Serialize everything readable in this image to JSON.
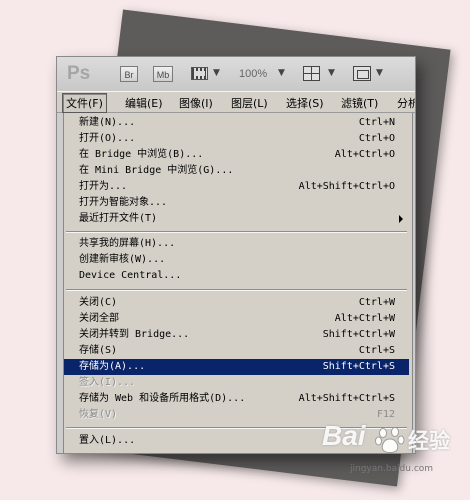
{
  "app": {
    "logo": "Ps",
    "bridge_button": "Br",
    "mini_bridge_button": "Mb",
    "zoom": "100%"
  },
  "menubar": [
    {
      "label": "文件(F)",
      "active": true
    },
    {
      "label": "编辑(E)"
    },
    {
      "label": "图像(I)"
    },
    {
      "label": "图层(L)"
    },
    {
      "label": "选择(S)"
    },
    {
      "label": "滤镜(T)"
    },
    {
      "label": "分析"
    }
  ],
  "file_menu": [
    {
      "label": "新建(N)...",
      "shortcut": "Ctrl+N"
    },
    {
      "label": "打开(O)...",
      "shortcut": "Ctrl+O"
    },
    {
      "label": "在 Bridge 中浏览(B)...",
      "shortcut": "Alt+Ctrl+O"
    },
    {
      "label": "在 Mini Bridge 中浏览(G)...",
      "shortcut": ""
    },
    {
      "label": "打开为...",
      "shortcut": "Alt+Shift+Ctrl+O"
    },
    {
      "label": "打开为智能对象...",
      "shortcut": ""
    },
    {
      "label": "最近打开文件(T)",
      "shortcut": "",
      "submenu": true
    },
    {
      "separator": true
    },
    {
      "label": "共享我的屏幕(H)...",
      "shortcut": ""
    },
    {
      "label": "创建新审核(W)...",
      "shortcut": ""
    },
    {
      "label": "Device Central...",
      "shortcut": ""
    },
    {
      "separator": true
    },
    {
      "label": "关闭(C)",
      "shortcut": "Ctrl+W"
    },
    {
      "label": "关闭全部",
      "shortcut": "Alt+Ctrl+W"
    },
    {
      "label": "关闭并转到 Bridge...",
      "shortcut": "Shift+Ctrl+W"
    },
    {
      "label": "存储(S)",
      "shortcut": "Ctrl+S"
    },
    {
      "label": "存储为(A)...",
      "shortcut": "Shift+Ctrl+S",
      "selected": true
    },
    {
      "label": "签入(I)...",
      "shortcut": "",
      "disabled": true
    },
    {
      "label": "存储为 Web 和设备所用格式(D)...",
      "shortcut": "Alt+Shift+Ctrl+S"
    },
    {
      "label": "恢复(V)",
      "shortcut": "F12",
      "disabled": true
    },
    {
      "separator": true
    },
    {
      "label": "置入(L)...",
      "shortcut": ""
    }
  ],
  "watermark": {
    "logo_text": "Bai",
    "brand_text": "经验",
    "url": "jingyan.baidu.com"
  },
  "colors": {
    "selection": "#0a246a",
    "menu_bg": "#d4d0c8",
    "background": "#f7e9e9"
  }
}
